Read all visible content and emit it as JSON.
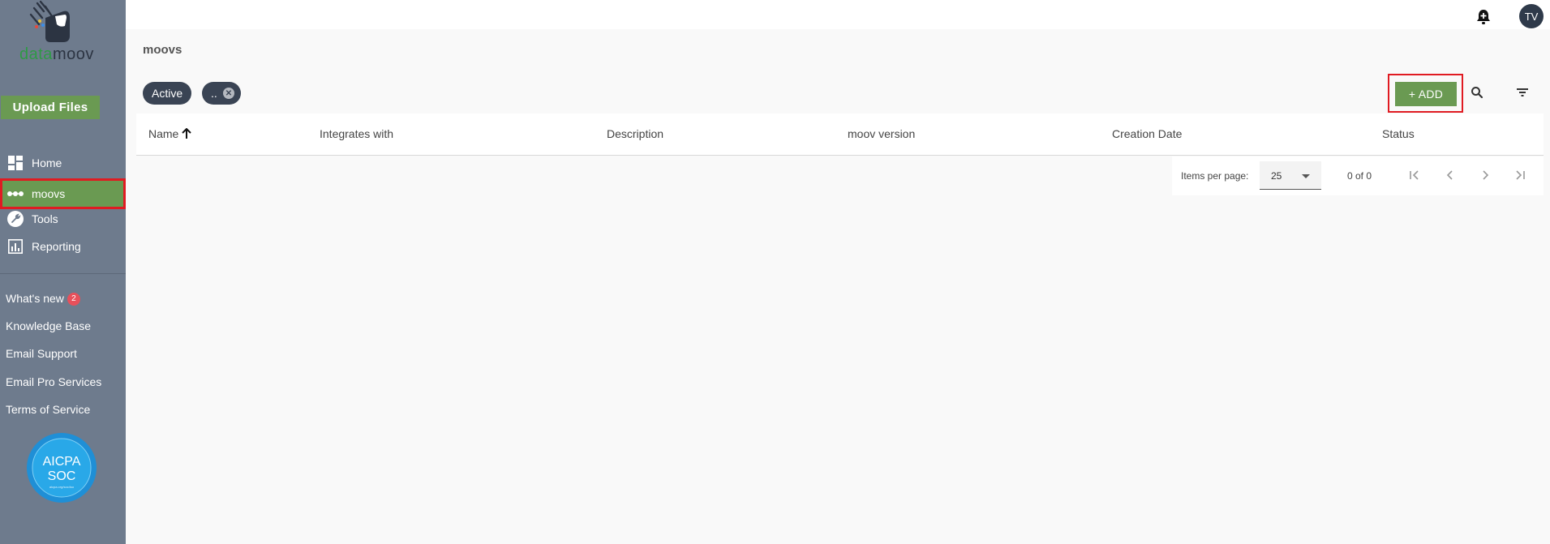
{
  "brand": {
    "logo_text_a": "data",
    "logo_text_b": "moov"
  },
  "sidebar": {
    "upload_label": "Upload Files",
    "items": [
      {
        "label": "Home",
        "icon": "dashboard-icon"
      },
      {
        "label": "moovs",
        "icon": "moovs-dots-icon",
        "active": true
      },
      {
        "label": "Tools",
        "icon": "wrench-icon"
      },
      {
        "label": "Reporting",
        "icon": "bar-chart-icon"
      }
    ],
    "links": [
      {
        "label": "What's new",
        "badge": "2"
      },
      {
        "label": "Knowledge Base"
      },
      {
        "label": "Email Support"
      },
      {
        "label": "Email Pro Services"
      },
      {
        "label": "Terms of Service"
      }
    ],
    "certification": {
      "line1": "AICPA",
      "line2": "SOC",
      "caption": "aicpa.org/soc4so"
    }
  },
  "header": {
    "avatar_initials": "TV"
  },
  "main": {
    "title": "moovs",
    "filters": [
      {
        "label": "Active"
      },
      {
        "label": ".."
      }
    ],
    "add_label": "+ ADD",
    "table": {
      "columns": [
        "Name",
        "Integrates with",
        "Description",
        "moov version",
        "Creation Date",
        "Status"
      ],
      "sorted_column": "Name",
      "sort_direction": "ascending",
      "rows": []
    },
    "paginator": {
      "items_per_page_label": "Items per page:",
      "items_per_page": "25",
      "range": "0 of 0"
    }
  },
  "colors": {
    "sidebar": "#6e7b8d",
    "accent_green": "#6a9a52",
    "highlight_red": "#e01b22",
    "chip": "#3a4454"
  }
}
